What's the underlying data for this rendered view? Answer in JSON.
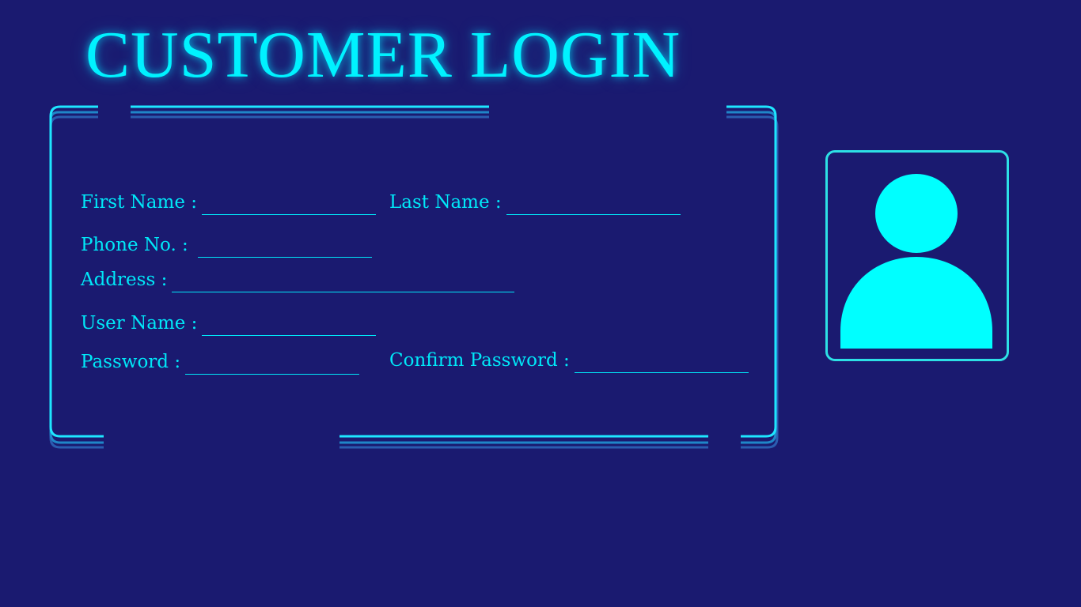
{
  "title": "CUSTOMER LOGIN",
  "colors": {
    "background": "#1a1a70",
    "accent": "#00f2ff",
    "frame_shadow": "#2a5cb0"
  },
  "form": {
    "first_name": {
      "label": "First Name :",
      "value": ""
    },
    "last_name": {
      "label": "Last Name :",
      "value": ""
    },
    "phone": {
      "label": "Phone No. :",
      "value": ""
    },
    "address": {
      "label": "Address :",
      "value": ""
    },
    "username": {
      "label": "User Name :",
      "value": ""
    },
    "password": {
      "label": "Password :",
      "value": ""
    },
    "confirm_password": {
      "label": "Confirm Password :",
      "value": ""
    }
  },
  "avatar": {
    "icon": "user-avatar-icon"
  }
}
